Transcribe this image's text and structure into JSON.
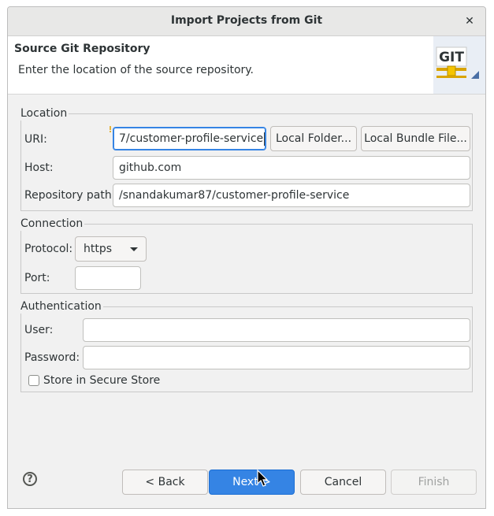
{
  "window": {
    "title": "Import Projects from Git",
    "close_glyph": "✕"
  },
  "header": {
    "title": "Source Git Repository",
    "description": "Enter the location of the source repository.",
    "logo_text": "GIT"
  },
  "location": {
    "legend": "Location",
    "uri_label": "URI:",
    "uri_value": "7/customer-profile-service",
    "local_folder_button": "Local Folder...",
    "local_bundle_button": "Local Bundle File...",
    "host_label": "Host:",
    "host_value": "github.com",
    "repo_path_label": "Repository path:",
    "repo_path_value": "/snandakumar87/customer-profile-service"
  },
  "connection": {
    "legend": "Connection",
    "protocol_label": "Protocol:",
    "protocol_value": "https",
    "port_label": "Port:",
    "port_value": ""
  },
  "authentication": {
    "legend": "Authentication",
    "user_label": "User:",
    "user_value": "",
    "password_label": "Password:",
    "password_value": "",
    "store_label": "Store in Secure Store",
    "store_checked": false
  },
  "footer": {
    "help_glyph": "?",
    "back_button": "< Back",
    "next_button": "Next >",
    "cancel_button": "Cancel",
    "finish_button": "Finish"
  },
  "colors": {
    "accent": "#3584e4",
    "window_bg": "#f1f1f1",
    "disabled_text": "#a0a2a1"
  }
}
